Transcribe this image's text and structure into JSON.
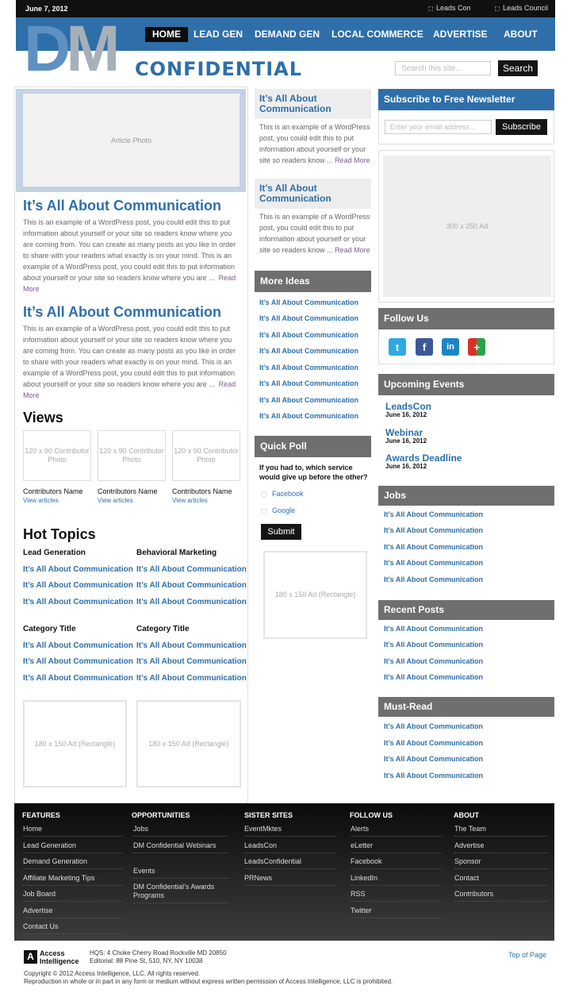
{
  "topbar": {
    "date": "June 7, 2012",
    "links": [
      "Leads Con",
      "Leads Council"
    ]
  },
  "nav": {
    "items": [
      "HOME",
      "LEAD GEN",
      "DEMAND GEN",
      "LOCAL COMMERCE",
      "ADVERTISE",
      "ABOUT"
    ]
  },
  "logo": {
    "d": "D",
    "m": "M",
    "confidential": "CONFIDENTIAL"
  },
  "search": {
    "placeholder": "Search this site...",
    "button": "Search"
  },
  "photo": {
    "label": "Article Photo"
  },
  "articles": [
    {
      "title": "It’s All About Communication",
      "body": "This is an example of a WordPress post, you could edit this to put information about yourself or your site so readers know where you are coming from. You can create as many posts as you like in order to share with your readers what exactly is on your mind. This is an example of a WordPress post, you could edit this to put information about yourself or your site so readers know where you are ...",
      "more": "Read More"
    },
    {
      "title": "It’s All About Communication",
      "body": "This is an example of a WordPress post, you could edit this to put information about yourself or your site so readers know where you are coming from. You can create as many posts as you like in order to share with your readers what exactly is on your mind. This is an example of a WordPress post, you could edit this to put information about yourself or your site so readers know where you are ...",
      "more": "Read More"
    }
  ],
  "views": {
    "title": "Views",
    "photo_label": "120 x 90 Contributor Photo",
    "contributors": [
      {
        "name": "Contributors Name",
        "link": "View articles"
      },
      {
        "name": "Contributors Name",
        "link": "View articles"
      },
      {
        "name": "Contributors Name",
        "link": "View articles"
      }
    ]
  },
  "hot": {
    "title": "Hot Topics",
    "groups": [
      {
        "title": "Lead Generation",
        "links": [
          "It’s All About Communication",
          "It’s All About Communication",
          "It’s All About Communication"
        ]
      },
      {
        "title": "Behavioral Marketing",
        "links": [
          "It’s All About Communication",
          "It’s All About Communication",
          "It’s All About Communication"
        ]
      },
      {
        "title": "Category Title",
        "links": [
          "It’s All About Communication",
          "It’s All About Communication",
          "It’s All About Communication"
        ]
      },
      {
        "title": "Category Title",
        "links": [
          "It’s All About Communication",
          "It’s All About Communication",
          "It’s All About Communication"
        ]
      }
    ]
  },
  "ads": {
    "rect": "180 x 150 Ad (Rectangle)",
    "big": "300 x 250 Ad"
  },
  "mid_posts": [
    {
      "title": "It’s All About Communication",
      "body": "This is an example of a WordPress post, you could edit this to put information about yourself or your site so readers know ...",
      "more": "Read More"
    },
    {
      "title": "It’s All About Communication",
      "body": "This is an example of a WordPress post, you could edit this to put information about yourself or your site so readers know ...",
      "more": "Read More"
    }
  ],
  "more_ideas": {
    "title": "More Ideas",
    "links": [
      "It’s All About Communication",
      "It’s All About Communication",
      "It’s All About Communication",
      "It’s All About Communication",
      "It’s All About Communication",
      "It’s All About Communication",
      "It’s All About Communication",
      "It’s All About Communication"
    ]
  },
  "poll": {
    "title": "Quick Poll",
    "question": "If you had to, which service would give up before the other?",
    "options": [
      "Facebook",
      "Google"
    ],
    "submit": "Submit"
  },
  "newsletter": {
    "title": "Subscribe to Free Newsletter",
    "placeholder": "Enter your email address...",
    "button": "Subscribe"
  },
  "follow": {
    "title": "Follow Us",
    "icons": [
      "twitter-icon",
      "facebook-icon",
      "linkedin-icon",
      "google-plus-icon"
    ]
  },
  "events": {
    "title": "Upcoming Events",
    "items": [
      {
        "name": "LeadsCon",
        "date": "June 16, 2012"
      },
      {
        "name": "Webinar",
        "date": "June 16, 2012"
      },
      {
        "name": "Awards Deadline",
        "date": "June 16, 2012"
      }
    ]
  },
  "jobs": {
    "title": "Jobs",
    "links": [
      "It’s All About Communication",
      "It’s All About Communication",
      "It’s All About Communication",
      "It’s All About Communication",
      "It’s All About Communication"
    ]
  },
  "recent": {
    "title": "Recent Posts",
    "links": [
      "It’s All About Communication",
      "It’s All About Communication",
      "It’s All About Communication",
      "It’s All About Communication"
    ]
  },
  "mustread": {
    "title": "Must-Read",
    "links": [
      "It’s All About Communication",
      "It’s All About Communication",
      "It’s All About Communication",
      "It’s All About Communication"
    ]
  },
  "footer": {
    "cols": [
      {
        "title": "FEATURES",
        "links": [
          "Home",
          "Lead Generation",
          "Demand Generation",
          "Affiliate Marketing Tips",
          "Job Board",
          "Advertise",
          "Contact Us"
        ]
      },
      {
        "title": "OPPORTUNITIES",
        "links": [
          "Jobs",
          "DM Confidential Webinars",
          "Events",
          "DM Confidential’s Awards Programs"
        ]
      },
      {
        "title": "SISTER SITES",
        "links": [
          "EventMktes",
          "LeadsCon",
          "LeadsConfidential",
          "PRNews"
        ]
      },
      {
        "title": "FOLLOW US",
        "links": [
          "Alerts",
          "eLetter",
          "Facebook",
          "LinkedIn",
          "RSS",
          "Twitter"
        ]
      },
      {
        "title": "ABOUT",
        "links": [
          "The Team",
          "Advertise",
          "Sponsor",
          "Contact",
          "Contributors"
        ]
      }
    ]
  },
  "bottom": {
    "company1": "Access",
    "company2": "Intelligence",
    "hq": "HQS: 4 Choke Cherry Road Rockville MD 20850",
    "editorial": "Editorial:  88 Pine St, 510, NY, NY 10038",
    "top": "Top of Page",
    "copyright": "Copyright © 2012 Access Intelligence, LLC. All rights reserved.",
    "repro": "Reproduction in whole or in part in any form or medium without express written permission of Access Intelligence, LLC is prohibited."
  },
  "colors": {
    "brand_blue": "#2e6fa9",
    "nav_bg": "#2e6fa9",
    "header_gray": "#6f6f6f"
  }
}
